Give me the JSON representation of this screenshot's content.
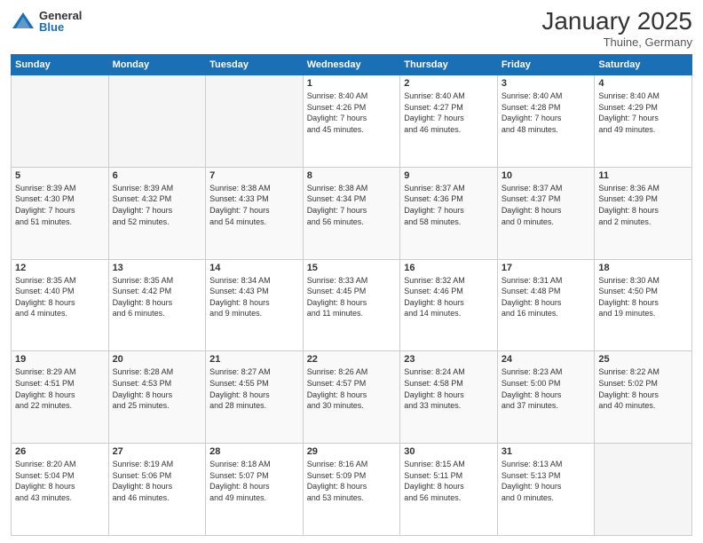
{
  "header": {
    "logo": {
      "general": "General",
      "blue": "Blue"
    },
    "title": "January 2025",
    "location": "Thuine, Germany"
  },
  "weekdays": [
    "Sunday",
    "Monday",
    "Tuesday",
    "Wednesday",
    "Thursday",
    "Friday",
    "Saturday"
  ],
  "weeks": [
    [
      {
        "day": "",
        "content": "",
        "empty": true
      },
      {
        "day": "",
        "content": "",
        "empty": true
      },
      {
        "day": "",
        "content": "",
        "empty": true
      },
      {
        "day": "1",
        "content": "Sunrise: 8:40 AM\nSunset: 4:26 PM\nDaylight: 7 hours\nand 45 minutes.",
        "empty": false
      },
      {
        "day": "2",
        "content": "Sunrise: 8:40 AM\nSunset: 4:27 PM\nDaylight: 7 hours\nand 46 minutes.",
        "empty": false
      },
      {
        "day": "3",
        "content": "Sunrise: 8:40 AM\nSunset: 4:28 PM\nDaylight: 7 hours\nand 48 minutes.",
        "empty": false
      },
      {
        "day": "4",
        "content": "Sunrise: 8:40 AM\nSunset: 4:29 PM\nDaylight: 7 hours\nand 49 minutes.",
        "empty": false
      }
    ],
    [
      {
        "day": "5",
        "content": "Sunrise: 8:39 AM\nSunset: 4:30 PM\nDaylight: 7 hours\nand 51 minutes.",
        "empty": false,
        "shaded": true
      },
      {
        "day": "6",
        "content": "Sunrise: 8:39 AM\nSunset: 4:32 PM\nDaylight: 7 hours\nand 52 minutes.",
        "empty": false,
        "shaded": true
      },
      {
        "day": "7",
        "content": "Sunrise: 8:38 AM\nSunset: 4:33 PM\nDaylight: 7 hours\nand 54 minutes.",
        "empty": false,
        "shaded": true
      },
      {
        "day": "8",
        "content": "Sunrise: 8:38 AM\nSunset: 4:34 PM\nDaylight: 7 hours\nand 56 minutes.",
        "empty": false,
        "shaded": true
      },
      {
        "day": "9",
        "content": "Sunrise: 8:37 AM\nSunset: 4:36 PM\nDaylight: 7 hours\nand 58 minutes.",
        "empty": false,
        "shaded": true
      },
      {
        "day": "10",
        "content": "Sunrise: 8:37 AM\nSunset: 4:37 PM\nDaylight: 8 hours\nand 0 minutes.",
        "empty": false,
        "shaded": true
      },
      {
        "day": "11",
        "content": "Sunrise: 8:36 AM\nSunset: 4:39 PM\nDaylight: 8 hours\nand 2 minutes.",
        "empty": false,
        "shaded": true
      }
    ],
    [
      {
        "day": "12",
        "content": "Sunrise: 8:35 AM\nSunset: 4:40 PM\nDaylight: 8 hours\nand 4 minutes.",
        "empty": false
      },
      {
        "day": "13",
        "content": "Sunrise: 8:35 AM\nSunset: 4:42 PM\nDaylight: 8 hours\nand 6 minutes.",
        "empty": false
      },
      {
        "day": "14",
        "content": "Sunrise: 8:34 AM\nSunset: 4:43 PM\nDaylight: 8 hours\nand 9 minutes.",
        "empty": false
      },
      {
        "day": "15",
        "content": "Sunrise: 8:33 AM\nSunset: 4:45 PM\nDaylight: 8 hours\nand 11 minutes.",
        "empty": false
      },
      {
        "day": "16",
        "content": "Sunrise: 8:32 AM\nSunset: 4:46 PM\nDaylight: 8 hours\nand 14 minutes.",
        "empty": false
      },
      {
        "day": "17",
        "content": "Sunrise: 8:31 AM\nSunset: 4:48 PM\nDaylight: 8 hours\nand 16 minutes.",
        "empty": false
      },
      {
        "day": "18",
        "content": "Sunrise: 8:30 AM\nSunset: 4:50 PM\nDaylight: 8 hours\nand 19 minutes.",
        "empty": false
      }
    ],
    [
      {
        "day": "19",
        "content": "Sunrise: 8:29 AM\nSunset: 4:51 PM\nDaylight: 8 hours\nand 22 minutes.",
        "empty": false,
        "shaded": true
      },
      {
        "day": "20",
        "content": "Sunrise: 8:28 AM\nSunset: 4:53 PM\nDaylight: 8 hours\nand 25 minutes.",
        "empty": false,
        "shaded": true
      },
      {
        "day": "21",
        "content": "Sunrise: 8:27 AM\nSunset: 4:55 PM\nDaylight: 8 hours\nand 28 minutes.",
        "empty": false,
        "shaded": true
      },
      {
        "day": "22",
        "content": "Sunrise: 8:26 AM\nSunset: 4:57 PM\nDaylight: 8 hours\nand 30 minutes.",
        "empty": false,
        "shaded": true
      },
      {
        "day": "23",
        "content": "Sunrise: 8:24 AM\nSunset: 4:58 PM\nDaylight: 8 hours\nand 33 minutes.",
        "empty": false,
        "shaded": true
      },
      {
        "day": "24",
        "content": "Sunrise: 8:23 AM\nSunset: 5:00 PM\nDaylight: 8 hours\nand 37 minutes.",
        "empty": false,
        "shaded": true
      },
      {
        "day": "25",
        "content": "Sunrise: 8:22 AM\nSunset: 5:02 PM\nDaylight: 8 hours\nand 40 minutes.",
        "empty": false,
        "shaded": true
      }
    ],
    [
      {
        "day": "26",
        "content": "Sunrise: 8:20 AM\nSunset: 5:04 PM\nDaylight: 8 hours\nand 43 minutes.",
        "empty": false
      },
      {
        "day": "27",
        "content": "Sunrise: 8:19 AM\nSunset: 5:06 PM\nDaylight: 8 hours\nand 46 minutes.",
        "empty": false
      },
      {
        "day": "28",
        "content": "Sunrise: 8:18 AM\nSunset: 5:07 PM\nDaylight: 8 hours\nand 49 minutes.",
        "empty": false
      },
      {
        "day": "29",
        "content": "Sunrise: 8:16 AM\nSunset: 5:09 PM\nDaylight: 8 hours\nand 53 minutes.",
        "empty": false
      },
      {
        "day": "30",
        "content": "Sunrise: 8:15 AM\nSunset: 5:11 PM\nDaylight: 8 hours\nand 56 minutes.",
        "empty": false
      },
      {
        "day": "31",
        "content": "Sunrise: 8:13 AM\nSunset: 5:13 PM\nDaylight: 9 hours\nand 0 minutes.",
        "empty": false
      },
      {
        "day": "",
        "content": "",
        "empty": true
      }
    ]
  ]
}
